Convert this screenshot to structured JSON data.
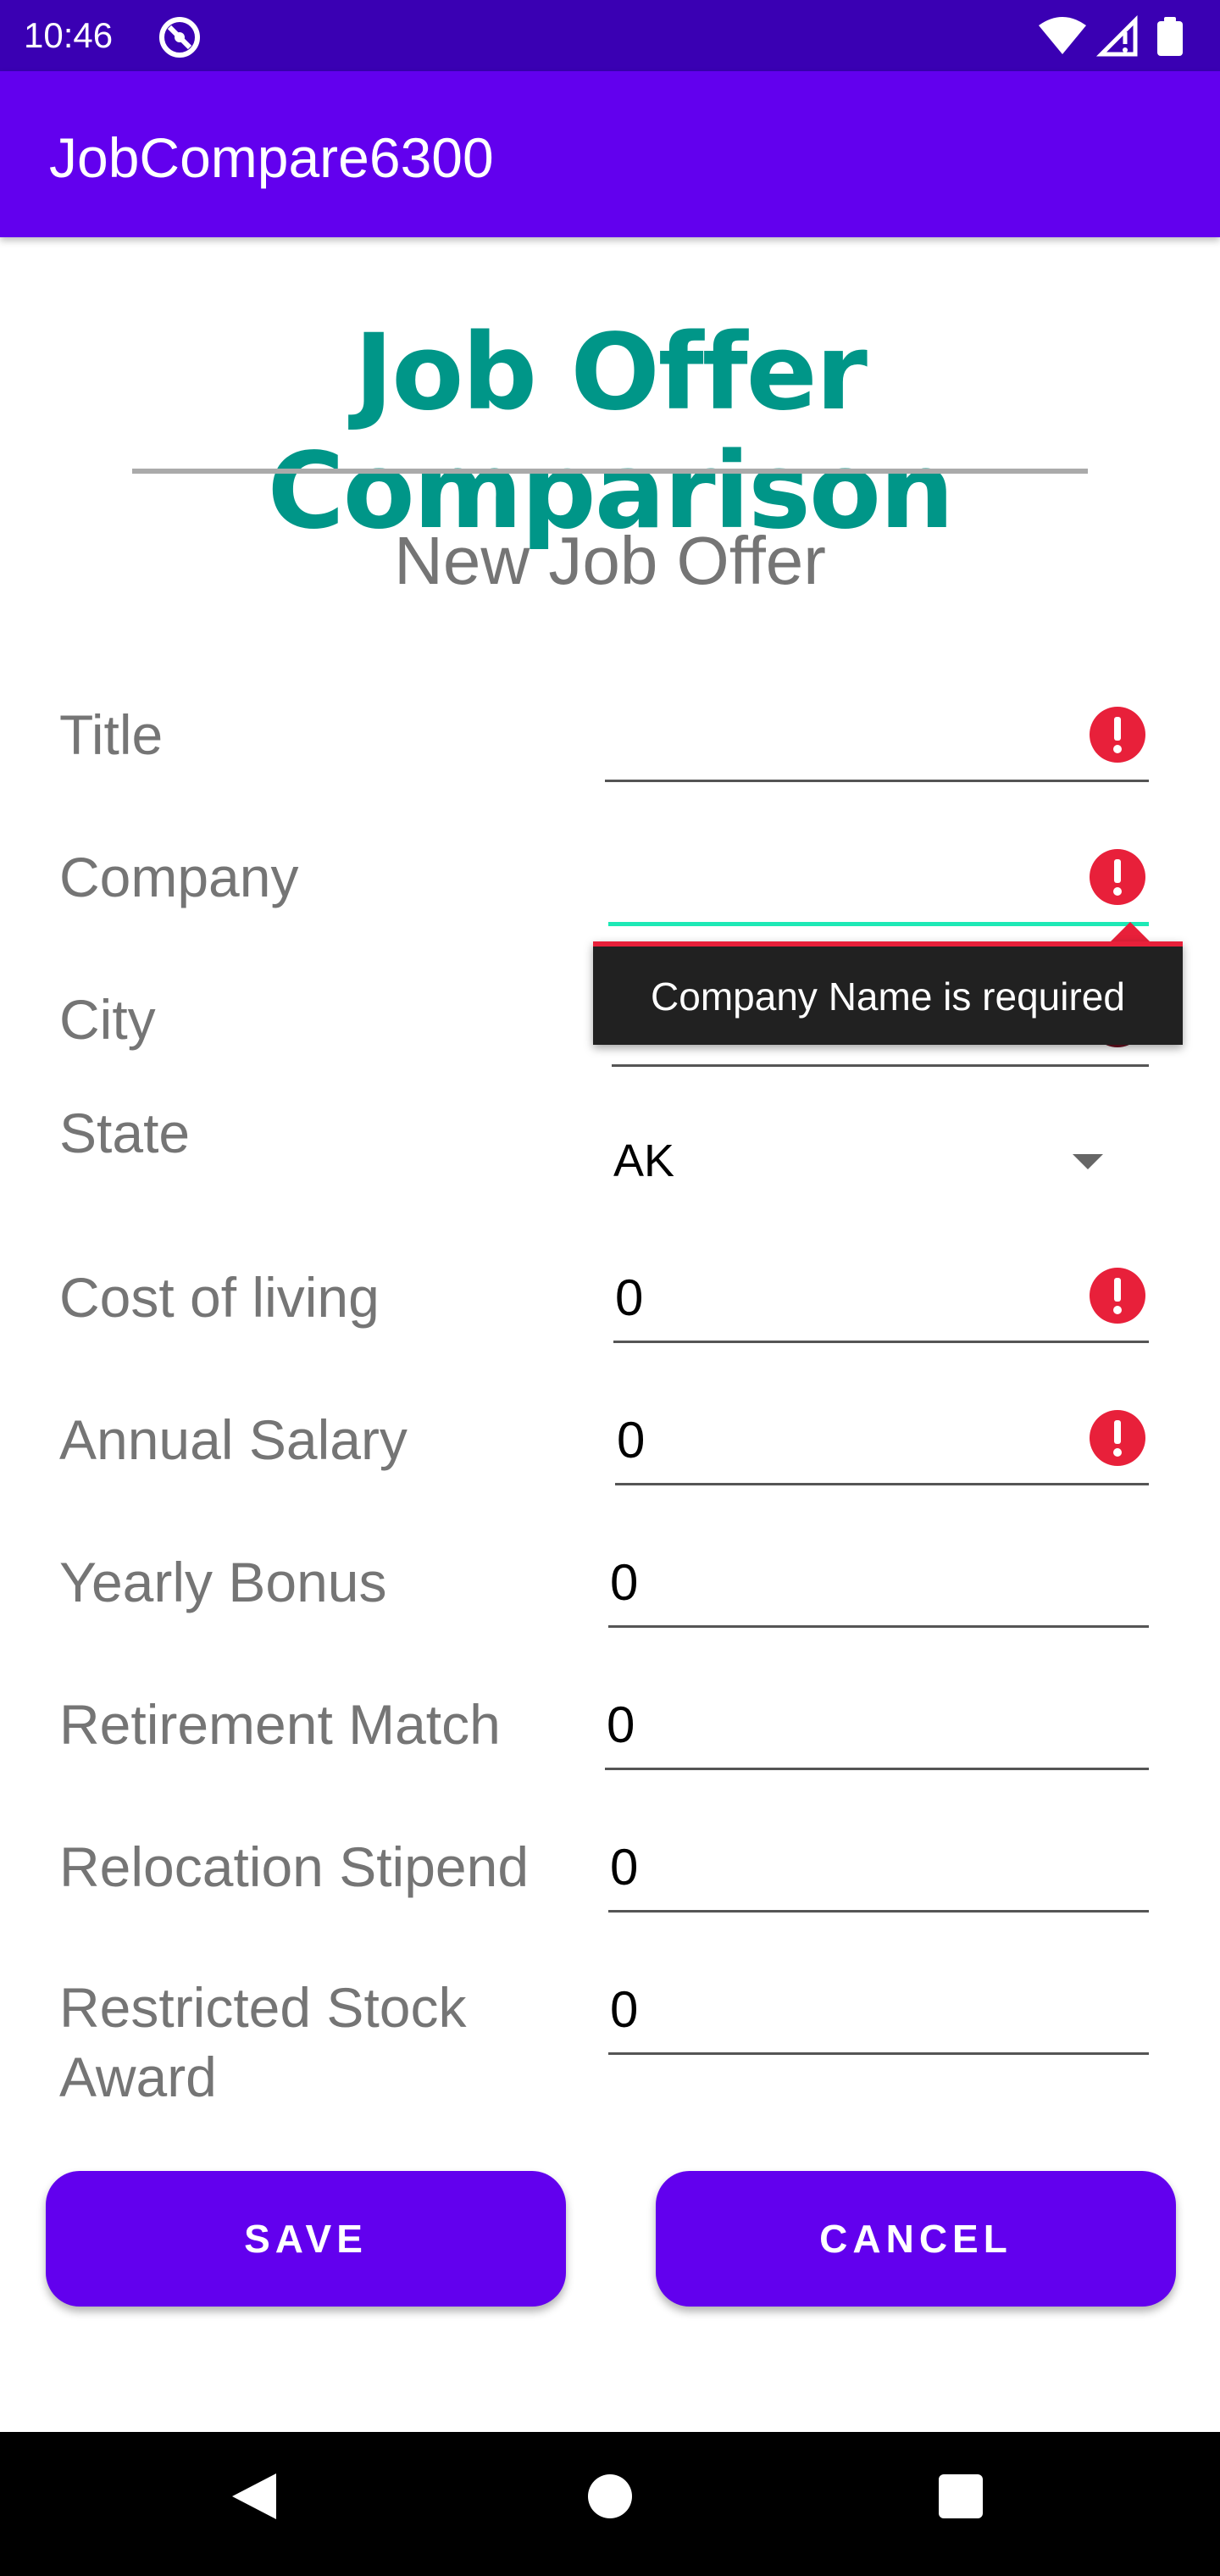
{
  "status_bar": {
    "time": "10:46"
  },
  "app_bar": {
    "title": "JobCompare6300"
  },
  "page": {
    "title": "Job Offer Comparison",
    "subtitle": "New Job Offer"
  },
  "fields": {
    "title": {
      "label": "Title",
      "value": ""
    },
    "company": {
      "label": "Company",
      "value": ""
    },
    "city": {
      "label": "City",
      "value": ""
    },
    "state": {
      "label": "State",
      "value": "AK"
    },
    "cost_of_living": {
      "label": "Cost of living",
      "value": "0"
    },
    "annual_salary": {
      "label": "Annual Salary",
      "value": "0"
    },
    "yearly_bonus": {
      "label": "Yearly Bonus",
      "value": "0"
    },
    "retirement_match": {
      "label": "Retirement Match",
      "value": "0"
    },
    "relocation_stipend": {
      "label": "Relocation Stipend",
      "value": "0"
    },
    "restricted_stock": {
      "label_line1": "Restricted Stock",
      "label_line2": "Award",
      "value": "0"
    }
  },
  "error_tooltip": {
    "text": "Company Name is required"
  },
  "buttons": {
    "save": "SAVE",
    "cancel": "CANCEL"
  },
  "icons": {
    "error": "error-icon",
    "wifi": "wifi-icon",
    "signal": "signal-icon",
    "battery": "battery-icon",
    "dnd": "do-not-disturb-icon"
  },
  "colors": {
    "primary": "#6200ee",
    "status_bar": "#3a00b3",
    "title": "#009688",
    "error": "#e8203a",
    "focus": "#1de9b6"
  }
}
